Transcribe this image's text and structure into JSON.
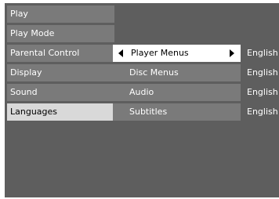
{
  "main_menu": {
    "items": [
      {
        "label": "Play"
      },
      {
        "label": "Play Mode"
      },
      {
        "label": "Parental Control"
      },
      {
        "label": "Display"
      },
      {
        "label": "Sound"
      },
      {
        "label": "Languages"
      }
    ],
    "selected_label": "Languages"
  },
  "submenu": {
    "items": [
      {
        "label": "Player Menus",
        "value": "English"
      },
      {
        "label": "Disc Menus",
        "value": "English"
      },
      {
        "label": "Audio",
        "value": "English"
      },
      {
        "label": "Subtitles",
        "value": "English"
      }
    ],
    "active_label": "Player Menus"
  },
  "colors": {
    "background": "#5e5e5e",
    "item": "#7a7a7a",
    "selected": "#d9d9d9",
    "active": "#ffffff"
  },
  "icons": {
    "left": "arrow-left-icon",
    "right": "arrow-right-icon"
  }
}
